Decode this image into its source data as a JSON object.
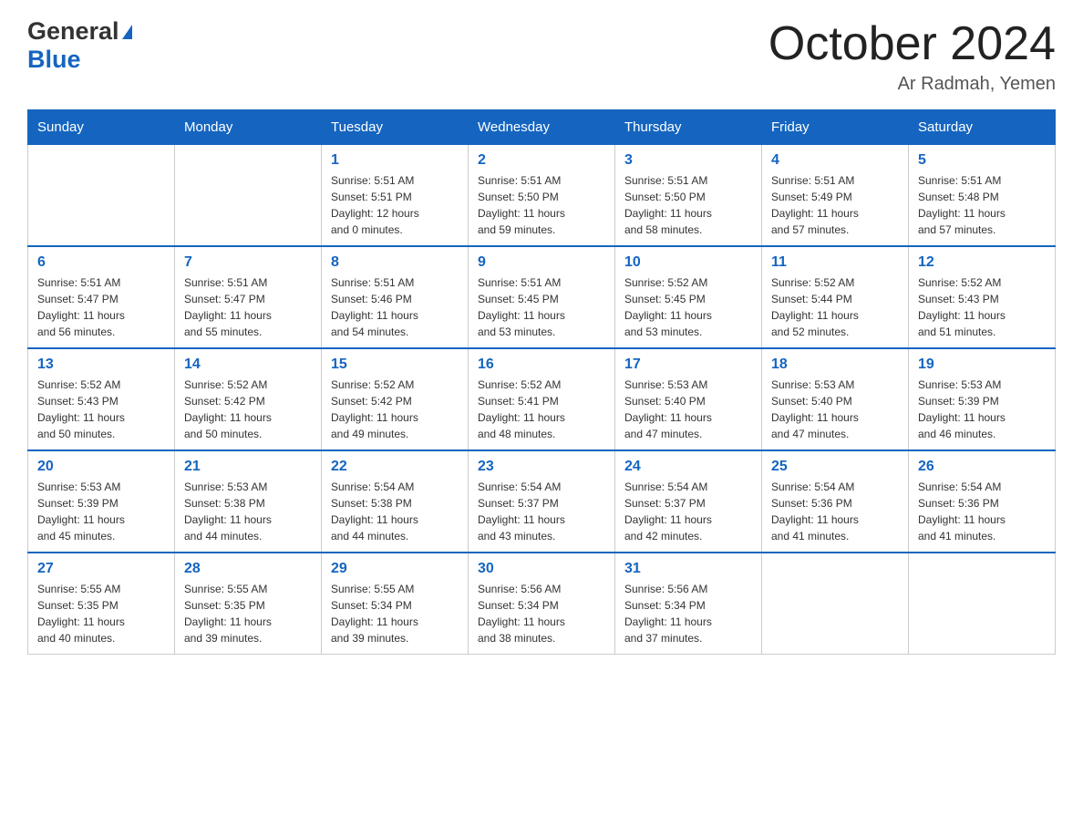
{
  "header": {
    "logo_general": "General",
    "logo_blue": "Blue",
    "month_title": "October 2024",
    "location": "Ar Radmah, Yemen"
  },
  "days_of_week": [
    "Sunday",
    "Monday",
    "Tuesday",
    "Wednesday",
    "Thursday",
    "Friday",
    "Saturday"
  ],
  "weeks": [
    {
      "days": [
        {
          "number": "",
          "info": ""
        },
        {
          "number": "",
          "info": ""
        },
        {
          "number": "1",
          "info": "Sunrise: 5:51 AM\nSunset: 5:51 PM\nDaylight: 12 hours\nand 0 minutes."
        },
        {
          "number": "2",
          "info": "Sunrise: 5:51 AM\nSunset: 5:50 PM\nDaylight: 11 hours\nand 59 minutes."
        },
        {
          "number": "3",
          "info": "Sunrise: 5:51 AM\nSunset: 5:50 PM\nDaylight: 11 hours\nand 58 minutes."
        },
        {
          "number": "4",
          "info": "Sunrise: 5:51 AM\nSunset: 5:49 PM\nDaylight: 11 hours\nand 57 minutes."
        },
        {
          "number": "5",
          "info": "Sunrise: 5:51 AM\nSunset: 5:48 PM\nDaylight: 11 hours\nand 57 minutes."
        }
      ]
    },
    {
      "days": [
        {
          "number": "6",
          "info": "Sunrise: 5:51 AM\nSunset: 5:47 PM\nDaylight: 11 hours\nand 56 minutes."
        },
        {
          "number": "7",
          "info": "Sunrise: 5:51 AM\nSunset: 5:47 PM\nDaylight: 11 hours\nand 55 minutes."
        },
        {
          "number": "8",
          "info": "Sunrise: 5:51 AM\nSunset: 5:46 PM\nDaylight: 11 hours\nand 54 minutes."
        },
        {
          "number": "9",
          "info": "Sunrise: 5:51 AM\nSunset: 5:45 PM\nDaylight: 11 hours\nand 53 minutes."
        },
        {
          "number": "10",
          "info": "Sunrise: 5:52 AM\nSunset: 5:45 PM\nDaylight: 11 hours\nand 53 minutes."
        },
        {
          "number": "11",
          "info": "Sunrise: 5:52 AM\nSunset: 5:44 PM\nDaylight: 11 hours\nand 52 minutes."
        },
        {
          "number": "12",
          "info": "Sunrise: 5:52 AM\nSunset: 5:43 PM\nDaylight: 11 hours\nand 51 minutes."
        }
      ]
    },
    {
      "days": [
        {
          "number": "13",
          "info": "Sunrise: 5:52 AM\nSunset: 5:43 PM\nDaylight: 11 hours\nand 50 minutes."
        },
        {
          "number": "14",
          "info": "Sunrise: 5:52 AM\nSunset: 5:42 PM\nDaylight: 11 hours\nand 50 minutes."
        },
        {
          "number": "15",
          "info": "Sunrise: 5:52 AM\nSunset: 5:42 PM\nDaylight: 11 hours\nand 49 minutes."
        },
        {
          "number": "16",
          "info": "Sunrise: 5:52 AM\nSunset: 5:41 PM\nDaylight: 11 hours\nand 48 minutes."
        },
        {
          "number": "17",
          "info": "Sunrise: 5:53 AM\nSunset: 5:40 PM\nDaylight: 11 hours\nand 47 minutes."
        },
        {
          "number": "18",
          "info": "Sunrise: 5:53 AM\nSunset: 5:40 PM\nDaylight: 11 hours\nand 47 minutes."
        },
        {
          "number": "19",
          "info": "Sunrise: 5:53 AM\nSunset: 5:39 PM\nDaylight: 11 hours\nand 46 minutes."
        }
      ]
    },
    {
      "days": [
        {
          "number": "20",
          "info": "Sunrise: 5:53 AM\nSunset: 5:39 PM\nDaylight: 11 hours\nand 45 minutes."
        },
        {
          "number": "21",
          "info": "Sunrise: 5:53 AM\nSunset: 5:38 PM\nDaylight: 11 hours\nand 44 minutes."
        },
        {
          "number": "22",
          "info": "Sunrise: 5:54 AM\nSunset: 5:38 PM\nDaylight: 11 hours\nand 44 minutes."
        },
        {
          "number": "23",
          "info": "Sunrise: 5:54 AM\nSunset: 5:37 PM\nDaylight: 11 hours\nand 43 minutes."
        },
        {
          "number": "24",
          "info": "Sunrise: 5:54 AM\nSunset: 5:37 PM\nDaylight: 11 hours\nand 42 minutes."
        },
        {
          "number": "25",
          "info": "Sunrise: 5:54 AM\nSunset: 5:36 PM\nDaylight: 11 hours\nand 41 minutes."
        },
        {
          "number": "26",
          "info": "Sunrise: 5:54 AM\nSunset: 5:36 PM\nDaylight: 11 hours\nand 41 minutes."
        }
      ]
    },
    {
      "days": [
        {
          "number": "27",
          "info": "Sunrise: 5:55 AM\nSunset: 5:35 PM\nDaylight: 11 hours\nand 40 minutes."
        },
        {
          "number": "28",
          "info": "Sunrise: 5:55 AM\nSunset: 5:35 PM\nDaylight: 11 hours\nand 39 minutes."
        },
        {
          "number": "29",
          "info": "Sunrise: 5:55 AM\nSunset: 5:34 PM\nDaylight: 11 hours\nand 39 minutes."
        },
        {
          "number": "30",
          "info": "Sunrise: 5:56 AM\nSunset: 5:34 PM\nDaylight: 11 hours\nand 38 minutes."
        },
        {
          "number": "31",
          "info": "Sunrise: 5:56 AM\nSunset: 5:34 PM\nDaylight: 11 hours\nand 37 minutes."
        },
        {
          "number": "",
          "info": ""
        },
        {
          "number": "",
          "info": ""
        }
      ]
    }
  ]
}
